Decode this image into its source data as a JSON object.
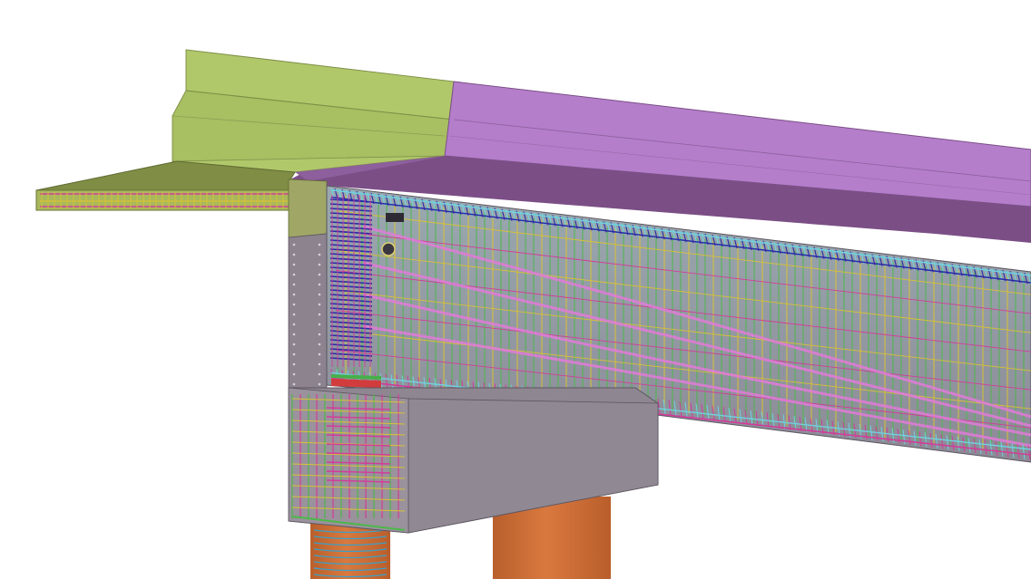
{
  "colors": {
    "background": "#ffffff",
    "wall_green": "#b1c86a",
    "wall_green_dark": "#9fb55c",
    "slab_olive": "#7f8d45",
    "slab_olive_light": "#a9b85c",
    "parapet_purple": "#b47ecb",
    "parapet_purple_dark": "#7b4f86",
    "girder_gray": "#8c838e",
    "girder_gray_light": "#a39aa5",
    "cap_gray": "#8e8690",
    "pier_orange": "#d4743d",
    "pier_orange_dark": "#b85f2c",
    "rebar_cyan": "#6fd3df",
    "rebar_blue": "#2a2aa8",
    "rebar_magenta": "#d23c9a",
    "rebar_green": "#4cb84a",
    "rebar_yellow": "#d8c234",
    "tendon_pink": "#e27ad8",
    "edge_dark": "#4a4450"
  },
  "scene": {
    "components": [
      "retaining-wall",
      "deck-slab",
      "parapet",
      "box-girder",
      "pier-cap",
      "pier-column"
    ],
    "pier_column_count": 2,
    "prestress_tendon_count": 4
  }
}
